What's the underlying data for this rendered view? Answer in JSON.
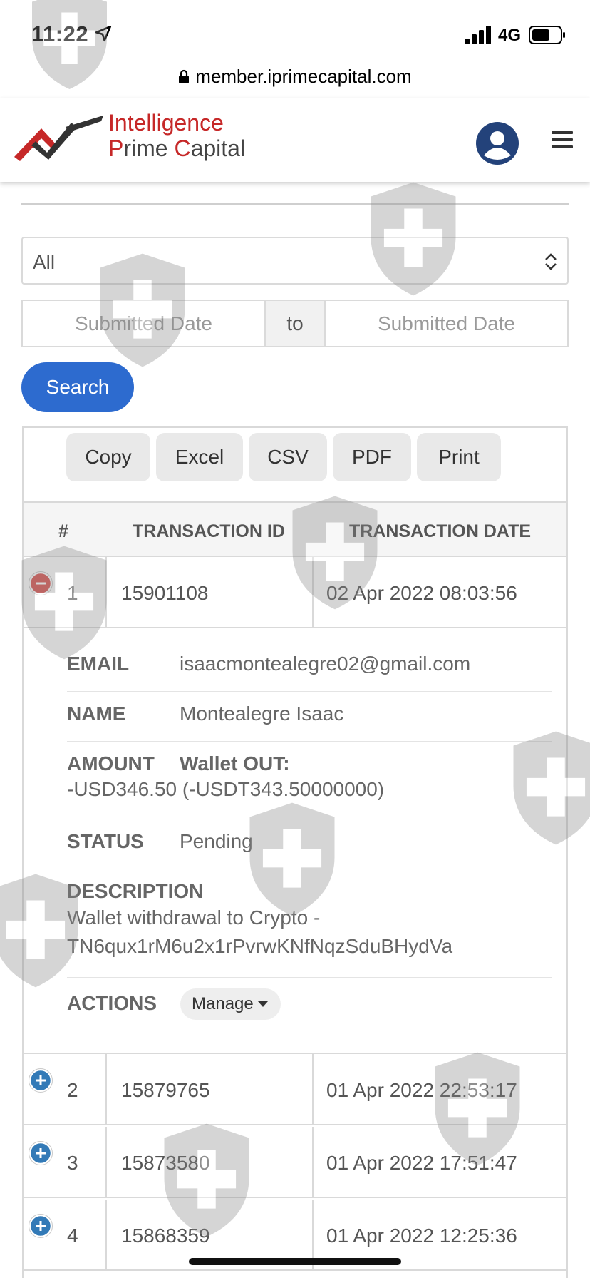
{
  "status_bar": {
    "time": "11:22",
    "network": "4G"
  },
  "browser": {
    "url": "member.iprimecapital.com"
  },
  "brand": {
    "line1": "Intelligence",
    "line2_a": "P",
    "line2_b": "rime ",
    "line2_c": "C",
    "line2_d": "apital",
    "accent_color": "#c62828"
  },
  "filters": {
    "select_value": "All",
    "date_from_placeholder": "Submitted Date",
    "date_to_label": "to",
    "date_to_placeholder": "Submitted Date",
    "search_label": "Search"
  },
  "export_buttons": [
    "Copy",
    "Excel",
    "CSV",
    "PDF",
    "Print"
  ],
  "table": {
    "headers": [
      "#",
      "TRANSACTION ID",
      "TRANSACTION DATE"
    ],
    "rows": [
      {
        "num": "1",
        "id": "15901108",
        "date": "02 Apr 2022 08:03:56",
        "expanded": true
      },
      {
        "num": "2",
        "id": "15879765",
        "date": "01 Apr 2022 22:53:17",
        "expanded": false
      },
      {
        "num": "3",
        "id": "15873580",
        "date": "01 Apr 2022 17:51:47",
        "expanded": false
      },
      {
        "num": "4",
        "id": "15868359",
        "date": "01 Apr 2022 12:25:36",
        "expanded": false
      }
    ]
  },
  "detail": {
    "email_label": "EMAIL",
    "email": "isaacmontealegre02@gmail.com",
    "name_label": "NAME",
    "name": "Montealegre Isaac",
    "amount_label": "AMOUNT",
    "amount_type": "Wallet OUT:",
    "amount_value": "-USD346.50 (-USDT343.50000000)",
    "status_label": "STATUS",
    "status": "Pending",
    "description_label": "DESCRIPTION",
    "description_line1": "Wallet withdrawal to Crypto -",
    "description_line2": "TN6qux1rM6u2x1rPvrwKNfNqzSduBHydVa",
    "actions_label": "ACTIONS",
    "manage_label": "Manage"
  },
  "colors": {
    "primary": "#2d6bcf",
    "collapse": "#d9534f",
    "expand": "#337ab7"
  }
}
